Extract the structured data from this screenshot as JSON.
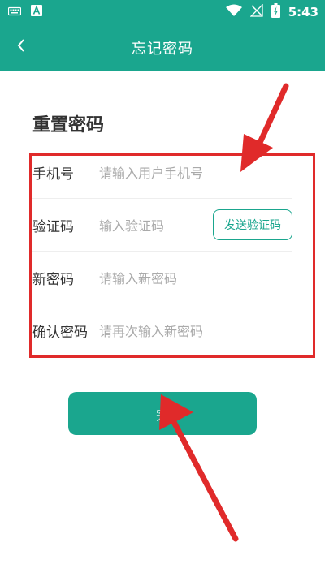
{
  "status_bar": {
    "time": "5:43",
    "icons": [
      "keyboard-icon",
      "a-notification-icon",
      "wifi-icon",
      "no-sim-icon",
      "battery-charging-icon"
    ]
  },
  "app_bar": {
    "title": "忘记密码",
    "back_icon": "chevron-left-icon"
  },
  "page": {
    "heading": "重置密码"
  },
  "form": {
    "phone": {
      "label": "手机号",
      "placeholder": "请输入用户手机号"
    },
    "code": {
      "label": "验证码",
      "placeholder": "输入验证码",
      "send_button": "发送验证码"
    },
    "new_password": {
      "label": "新密码",
      "placeholder": "请输入新密码"
    },
    "confirm_password": {
      "label": "确认密码",
      "placeholder": "请再次输入新密码"
    }
  },
  "actions": {
    "done_label": "完"
  },
  "annotations": {
    "highlight_color": "#e02a2a",
    "arrow_color": "#e02a2a"
  },
  "theme": {
    "primary": "#1aa68e",
    "text": "#333333",
    "placeholder": "#aaaaaa"
  }
}
